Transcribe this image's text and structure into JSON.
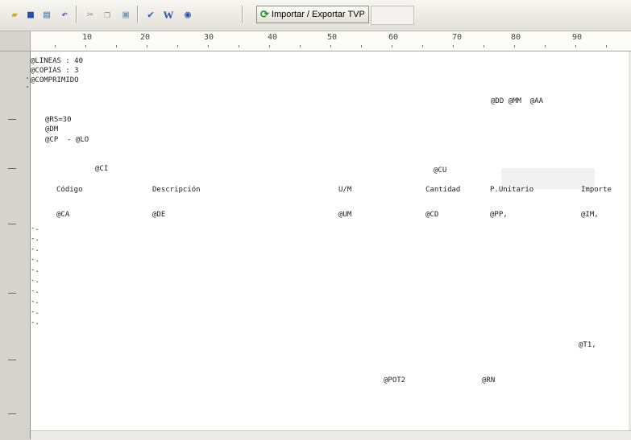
{
  "toolbar": {
    "icons": [
      "open-folder-icon",
      "save-icon",
      "print-preview-icon",
      "undo-icon",
      "cut-icon",
      "copy-icon",
      "paste-icon",
      "check-icon",
      "word-icon",
      "help-icon",
      "refresh-icon"
    ],
    "import_label": "Importar / Exportar TVP"
  },
  "ruler": {
    "labels": [
      "10",
      "20",
      "30",
      "40",
      "50",
      "60",
      "70",
      "80",
      "90"
    ]
  },
  "document": {
    "lines": [
      "@LINEAS : 40",
      "@COPIAS : 3",
      "@COMPRIMIDO",
      "@DD @MM  @AA",
      "@RS=30",
      "@DM",
      "@CP  - @LO",
      "@CI",
      "@CU",
      "Código",
      "Descripción",
      "U/M",
      "Cantidad",
      "P.Unitario",
      "Importe",
      "@CA",
      "@DE",
      "@UM",
      "@CD",
      "@PP,",
      "@IM,",
      "-.",
      "-.",
      "-.",
      "-.",
      "-.",
      "-.",
      "-.",
      "-.",
      "-.",
      "-.",
      "@T1,",
      "@POT2",
      "@RN"
    ]
  }
}
